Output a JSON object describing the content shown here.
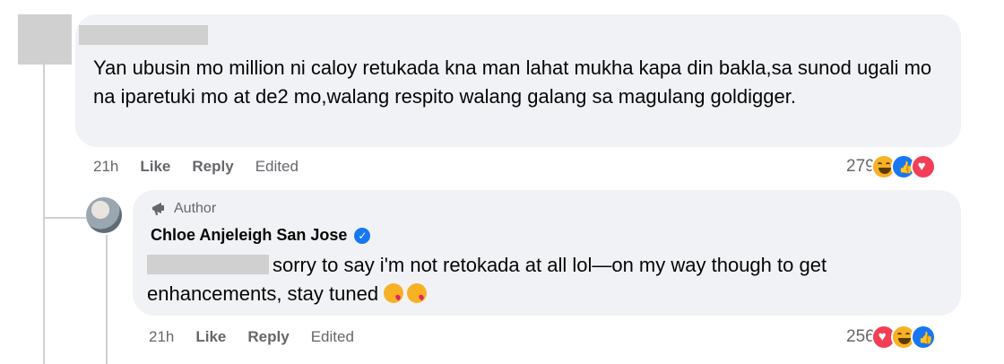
{
  "comment1": {
    "text": "Yan ubusin mo million ni caloy retukada kna man lahat mukha kapa din bakla,sa sunod ugali mo na iparetuki mo at de2 mo,walang respito walang galang sa magulang goldigger.",
    "time": "21h",
    "like_label": "Like",
    "reply_label": "Reply",
    "edited_label": "Edited",
    "reaction_count": "279",
    "reactions": [
      "haha-icon",
      "like-icon",
      "love-icon"
    ]
  },
  "comment2": {
    "author_badge": "Author",
    "author_name": "Chloe Anjeleigh San Jose",
    "text": "sorry to say i'm not retokada at all lol—on my way though to get enhancements, stay tuned",
    "time": "21h",
    "like_label": "Like",
    "reply_label": "Reply",
    "edited_label": "Edited",
    "reaction_count": "256",
    "reactions": [
      "love-icon",
      "haha-icon",
      "like-icon"
    ]
  }
}
